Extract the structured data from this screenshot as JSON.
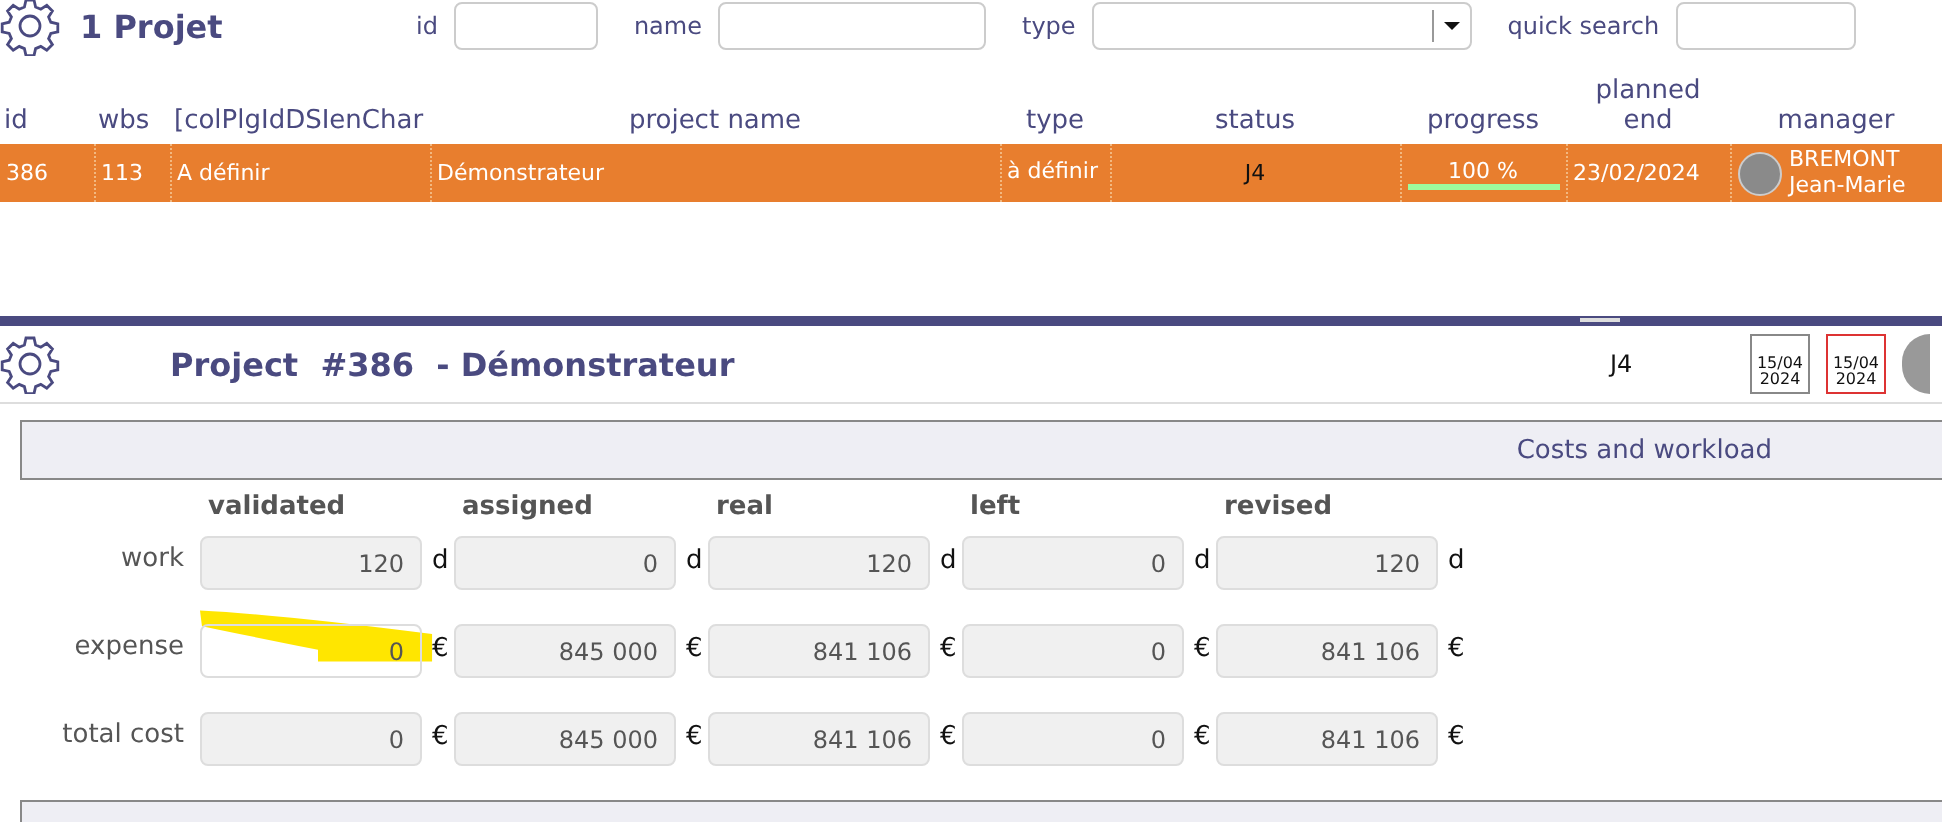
{
  "list_header": {
    "title": "1 Projet",
    "filters": [
      {
        "label": "id",
        "kind": "text"
      },
      {
        "label": "name",
        "kind": "text"
      },
      {
        "label": "type",
        "kind": "select"
      },
      {
        "label": "quick search",
        "kind": "text"
      }
    ]
  },
  "table": {
    "columns": [
      "id",
      "wbs",
      "[colPlgIdDSIenChar",
      "project name",
      "type",
      "status",
      "progress",
      "planned end",
      "manager"
    ],
    "rows": [
      {
        "selected": true,
        "id": "386",
        "wbs": "113",
        "col_3": "A définir",
        "project_name": "Démonstrateur",
        "type": "à définir",
        "status": "J4",
        "progress_text": "100 %",
        "level": 1,
        "planned_end": "23/02/2024",
        "manager": "BREMONT Jean-Marie"
      }
    ]
  },
  "detail": {
    "title": "Project  #386  - Démonstrateur",
    "status": "J4",
    "calendars": [
      {
        "kind": "edit",
        "day": "15/04",
        "year": "2024"
      },
      {
        "kind": "due",
        "day": "15/04",
        "year": "2024"
      }
    ],
    "section": "Costs and workload",
    "grid_columns": [
      "validated",
      "assigned",
      "real",
      "left",
      "revised"
    ],
    "grid_rows": [
      {
        "label": "work",
        "cells": [
          {
            "value": "120",
            "unit": "d",
            "readonly": true
          },
          {
            "value": "0",
            "unit": "d",
            "readonly": true
          },
          {
            "value": "120",
            "unit": "d",
            "readonly": true
          },
          {
            "value": "0",
            "unit": "d",
            "readonly": true
          },
          {
            "value": "120",
            "unit": "d",
            "readonly": true
          }
        ]
      },
      {
        "label": "expense",
        "cells": [
          {
            "value": "0",
            "unit": "€",
            "readonly": false
          },
          {
            "value": "845 000",
            "unit": "€",
            "readonly": true
          },
          {
            "value": "841 106",
            "unit": "€",
            "readonly": true
          },
          {
            "value": "0",
            "unit": "€",
            "readonly": true
          },
          {
            "value": "841 106",
            "unit": "€",
            "readonly": true
          }
        ]
      },
      {
        "label": "total cost",
        "cells": [
          {
            "value": "0",
            "unit": "€",
            "readonly": true
          },
          {
            "value": "845 000",
            "unit": "€",
            "readonly": true
          },
          {
            "value": "841 106",
            "unit": "€",
            "readonly": true
          },
          {
            "value": "0",
            "unit": "€",
            "readonly": true
          },
          {
            "value": "841 106",
            "unit": "€",
            "readonly": true
          }
        ]
      }
    ]
  }
}
